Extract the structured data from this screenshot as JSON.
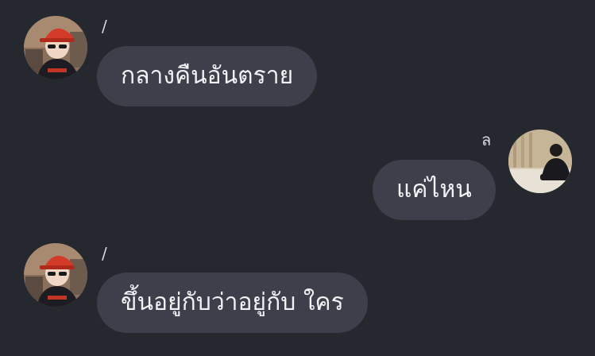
{
  "messages": [
    {
      "side": "left",
      "sender": "/",
      "text": "กลางคืนอันตราย",
      "avatar": "user-avatar-red-cap"
    },
    {
      "side": "right",
      "sender": "ล",
      "text": "แค่ไหน",
      "avatar": "user-avatar-room"
    },
    {
      "side": "left",
      "sender": "/",
      "text": "ขึ้นอยู่กับว่าอยู่กับ ใคร",
      "avatar": "user-avatar-red-cap"
    }
  ],
  "colors": {
    "background": "#262830",
    "bubble": "#3d3f4b",
    "text": "#f2f2f4",
    "sender_text": "#d7d8dd"
  }
}
